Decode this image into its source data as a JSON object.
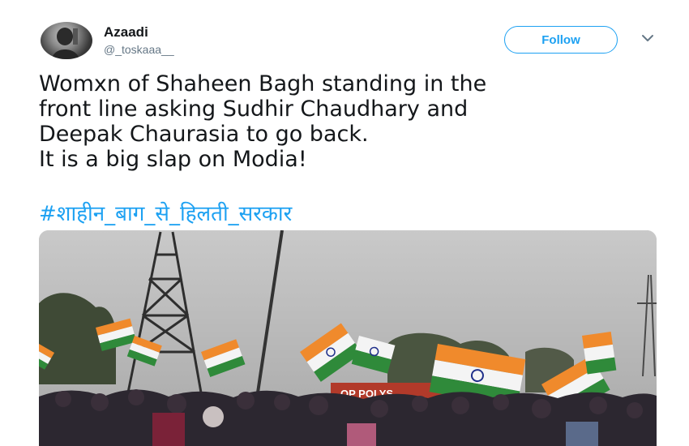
{
  "author": {
    "display_name": "Azaadi",
    "handle": "@_toskaaa__"
  },
  "follow_label": "Follow",
  "icons": {
    "menu": "chevron-down-icon"
  },
  "tweet": {
    "text": "Womxn of Shaheen Bagh standing in the\nfront line asking Sudhir Chaudhary and\nDeepak Chaurasia to go back.\nIt is a big slap on Modia!",
    "hashtag": "#शाहीन_बाग_से_हिलती_सरकार"
  },
  "media": {
    "banner_text": "OP POLYS"
  },
  "colors": {
    "accent": "#1da1f2",
    "text": "#14171a",
    "secondary": "#657786"
  }
}
